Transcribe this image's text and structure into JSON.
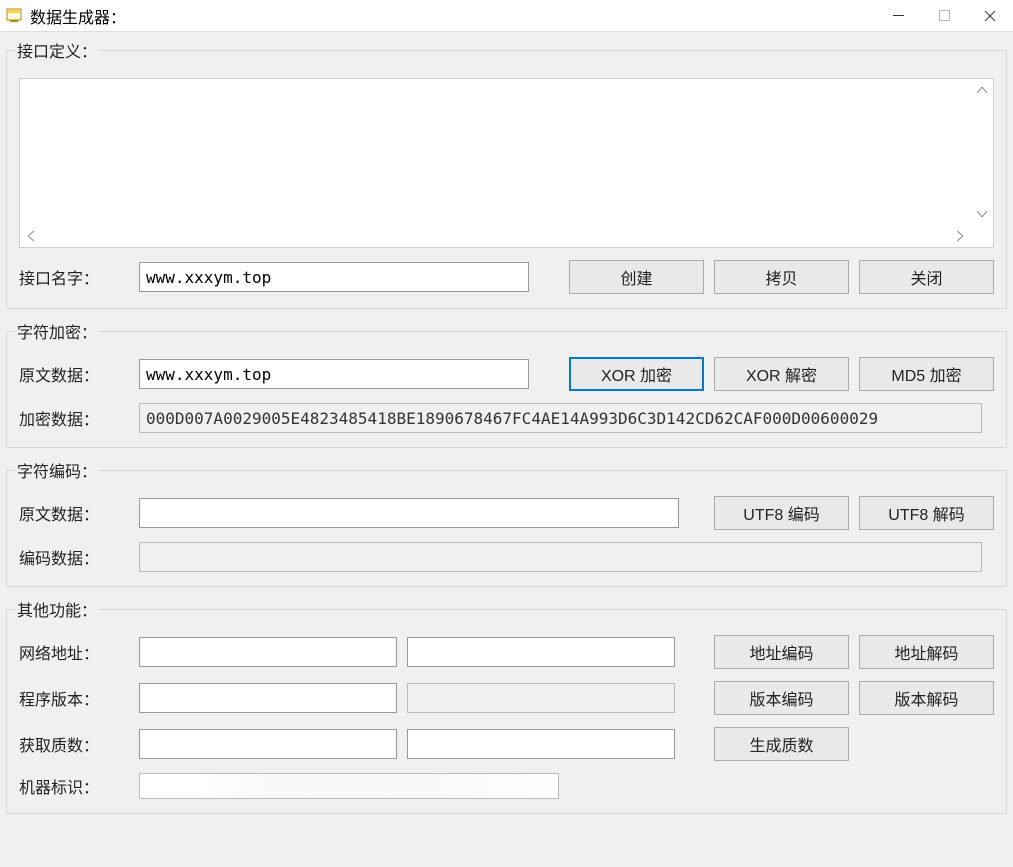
{
  "titlebar": {
    "title": "数据生成器："
  },
  "groups": {
    "interface_def": {
      "legend": "接口定义：",
      "textarea_value": "",
      "name_label": "接口名字：",
      "name_value": "www.xxxym.top",
      "create_btn": "创建",
      "copy_btn": "拷贝",
      "close_btn": "关闭"
    },
    "char_encrypt": {
      "legend": "字符加密：",
      "plain_label": "原文数据：",
      "plain_value": "www.xxxym.top",
      "xor_encrypt_btn": "XOR 加密",
      "xor_decrypt_btn": "XOR 解密",
      "md5_encrypt_btn": "MD5 加密",
      "cipher_label": "加密数据：",
      "cipher_value": "000D007A0029005E4823485418BE1890678467FC4AE14A993D6C3D142CD62CAF000D00600029"
    },
    "char_encode": {
      "legend": "字符编码：",
      "plain_label": "原文数据：",
      "plain_value": "",
      "utf8_encode_btn": "UTF8 编码",
      "utf8_decode_btn": "UTF8 解码",
      "encoded_label": "编码数据：",
      "encoded_value": ""
    },
    "other": {
      "legend": "其他功能：",
      "net_addr_label": "网络地址：",
      "net_addr_value1": "",
      "net_addr_value2": "",
      "addr_encode_btn": "地址编码",
      "addr_decode_btn": "地址解码",
      "version_label": "程序版本：",
      "version_value1": "",
      "version_value2": "",
      "ver_encode_btn": "版本编码",
      "ver_decode_btn": "版本解码",
      "prime_label": "获取质数：",
      "prime_value1": "",
      "prime_value2": "",
      "gen_prime_btn": "生成质数",
      "machine_label": "机器标识：",
      "machine_value": ""
    }
  }
}
